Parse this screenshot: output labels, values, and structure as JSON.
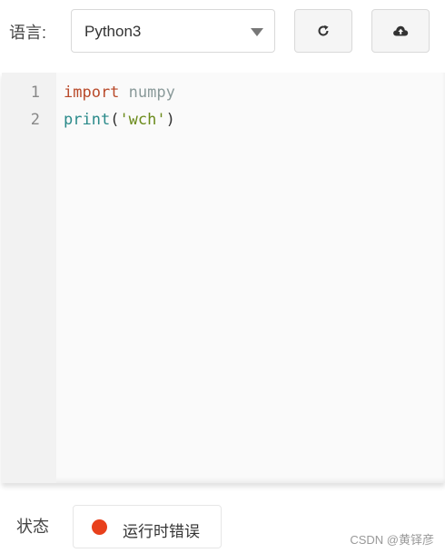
{
  "toolbar": {
    "language_label": "语言:",
    "language_value": "Python3",
    "refresh_icon": "refresh-icon",
    "upload_icon": "cloud-upload-icon"
  },
  "editor": {
    "lines": [
      {
        "number": "1",
        "tokens": [
          [
            "kw",
            "import"
          ],
          [
            "pun",
            " "
          ],
          [
            "id",
            "numpy"
          ]
        ]
      },
      {
        "number": "2",
        "tokens": [
          [
            "fn",
            "print"
          ],
          [
            "pun",
            "("
          ],
          [
            "str",
            "'wch'"
          ],
          [
            "pun",
            ")"
          ]
        ]
      }
    ]
  },
  "status": {
    "label": "状态",
    "value": "运行时错误",
    "dot_color": "#e8401c"
  },
  "watermark": "CSDN @黄铎彦"
}
